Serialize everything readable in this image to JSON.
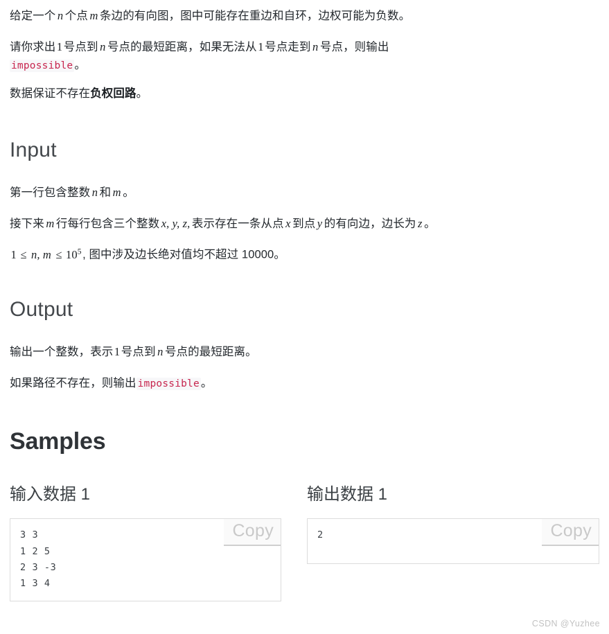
{
  "statement": {
    "paragraph_1": {
      "seg_1": "给定一个",
      "var_n": "n",
      "seg_2": "个点",
      "var_m": "m",
      "seg_3": "条边的有向图，图中可能存在重边和自环，边权可能为负数。"
    },
    "paragraph_2": {
      "seg_1": "请你求出",
      "num_1": "1",
      "seg_2": "号点到",
      "var_n": "n",
      "seg_3": "号点的最短距离，如果无法从",
      "num_2": "1",
      "seg_4": "号点走到",
      "var_n2": "n",
      "seg_5": "号点，则输出",
      "code": "impossible",
      "seg_6": "。"
    },
    "paragraph_3": {
      "seg_1": "数据保证不存在",
      "bold": "负权回路",
      "seg_2": "。"
    }
  },
  "input_section": {
    "heading": "Input",
    "paragraph_1": {
      "seg_1": "第一行包含整数",
      "var_n": "n",
      "seg_2": "和",
      "var_m": "m",
      "seg_3": "。"
    },
    "paragraph_2": {
      "seg_1": "接下来",
      "var_m": "m",
      "seg_2": "行每行包含三个整数",
      "vars": "x, y, z,",
      "seg_3": "表示存在一条从点",
      "var_x": "x",
      "seg_4": "到点",
      "var_y": "y",
      "seg_5": "的有向边，边长为",
      "var_z": "z",
      "seg_6": "。"
    },
    "paragraph_3": {
      "num_1": "1",
      "le_1": "≤",
      "vars": "n, m",
      "le_2": "≤",
      "power_base": "10",
      "power_exp": "5",
      "seg_tail": ", 图中涉及边长绝对值均不超过 10000。"
    }
  },
  "output_section": {
    "heading": "Output",
    "paragraph_1": {
      "seg_1": "输出一个整数，表示",
      "num_1": "1",
      "seg_2": "号点到",
      "var_n": "n",
      "seg_3": "号点的最短距离。"
    },
    "paragraph_2": {
      "seg_1": "如果路径不存在，则输出",
      "code": "impossible",
      "seg_2": "。"
    }
  },
  "samples_section": {
    "heading": "Samples",
    "input_sample": {
      "label": "输入数据 1",
      "copy_label": "Copy",
      "content": "3 3\n1 2 5\n2 3 -3\n1 3 4"
    },
    "output_sample": {
      "label": "输出数据 1",
      "copy_label": "Copy",
      "content": "2"
    }
  },
  "watermark": {
    "text": "CSDN @Yuzhee"
  },
  "colors": {
    "code_inline_text": "#c7254e",
    "code_inline_bg": "#f7f7f9",
    "body_text": "#24292e",
    "heading": "#44484c",
    "box_border": "#dcdcdc",
    "copy_label": "#c9c9c9",
    "watermark": "#c2c2c2"
  }
}
